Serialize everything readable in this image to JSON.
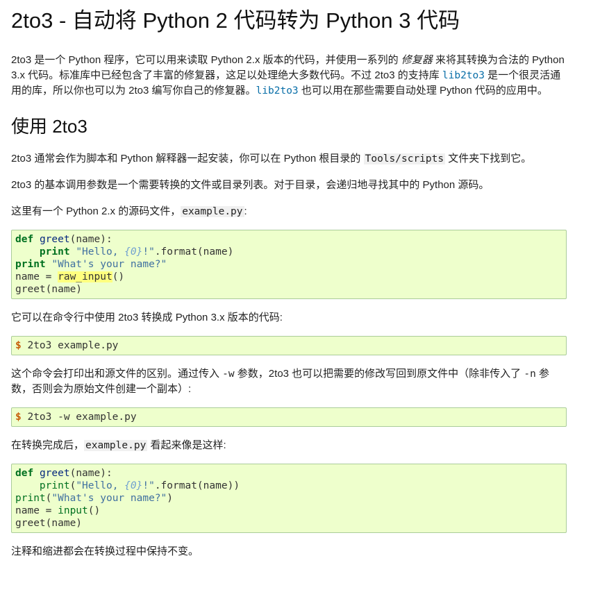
{
  "title": "2to3 - 自动将 Python 2 代码转为 Python 3 代码",
  "intro": {
    "t1": "2to3 是一个 Python 程序，它可以用来读取 Python 2.x 版本的代码，并使用一系列的 ",
    "em": "修复器",
    "t2": " 来将其转换为合法的 Python 3.x 代码。标准库中已经包含了丰富的修复器，这足以处理绝大多数代码。不过 2to3 的支持库 ",
    "link1": "lib2to3",
    "t3": " 是一个很灵活通用的库，所以你也可以为 2to3 编写你自己的修复器。",
    "link2": "lib2to3",
    "t4": " 也可以用在那些需要自动处理 Python 代码的应用中。"
  },
  "section_title": "使用 2to3",
  "p1": {
    "t1": "2to3 通常会作为脚本和 Python 解释器一起安装，你可以在 Python 根目录的 ",
    "code": "Tools/scripts",
    "t2": " 文件夹下找到它。"
  },
  "p2": "2to3 的基本调用参数是一个需要转换的文件或目录列表。对于目录，会递归地寻找其中的 Python 源码。",
  "p3": {
    "t1": "这里有一个 Python 2.x 的源码文件，",
    "code": "example.py",
    "t2": ":"
  },
  "code1": {
    "l1_kw": "def",
    "l1_fn": "greet",
    "l1_rest": "(name):",
    "l2_indent": "    ",
    "l2_kw": "print",
    "l2_s1": "\"Hello, ",
    "l2_interp": "{0}",
    "l2_s2": "!\"",
    "l2_rest": ".format(name)",
    "l3_kw": "print",
    "l3_str": "\"What's your name?\"",
    "l4_a": "name = ",
    "l4_hl": "raw_input",
    "l4_b": "()",
    "l5": "greet(name)"
  },
  "p4": "它可以在命令行中使用 2to3 转换成 Python 3.x 版本的代码:",
  "cmd1": {
    "prompt": "$",
    "text": " 2to3 example.py"
  },
  "p5": {
    "t1": "这个命令会打印出和源文件的区别。通过传入 ",
    "flag1": "-w",
    "t2": " 参数，2to3 也可以把需要的修改写回到原文件中（除非传入了 ",
    "flag2": "-n",
    "t3": " 参数，否则会为原始文件创建一个副本）:"
  },
  "cmd2": {
    "prompt": "$",
    "text": " 2to3 -w example.py"
  },
  "p6": {
    "t1": "在转换完成后，",
    "code": "example.py",
    "t2": " 看起来像是这样:"
  },
  "code2": {
    "l1_kw": "def",
    "l1_fn": "greet",
    "l1_rest": "(name):",
    "l2_indent": "    ",
    "l2_bi": "print",
    "l2_p1": "(",
    "l2_s1": "\"Hello, ",
    "l2_interp": "{0}",
    "l2_s2": "!\"",
    "l2_rest": ".format(name))",
    "l3_bi": "print",
    "l3_p1": "(",
    "l3_str": "\"What's your name?\"",
    "l3_p2": ")",
    "l4_a": "name = ",
    "l4_bi": "input",
    "l4_b": "()",
    "l5": "greet(name)"
  },
  "p7": "注释和缩进都会在转换过程中保持不变。"
}
